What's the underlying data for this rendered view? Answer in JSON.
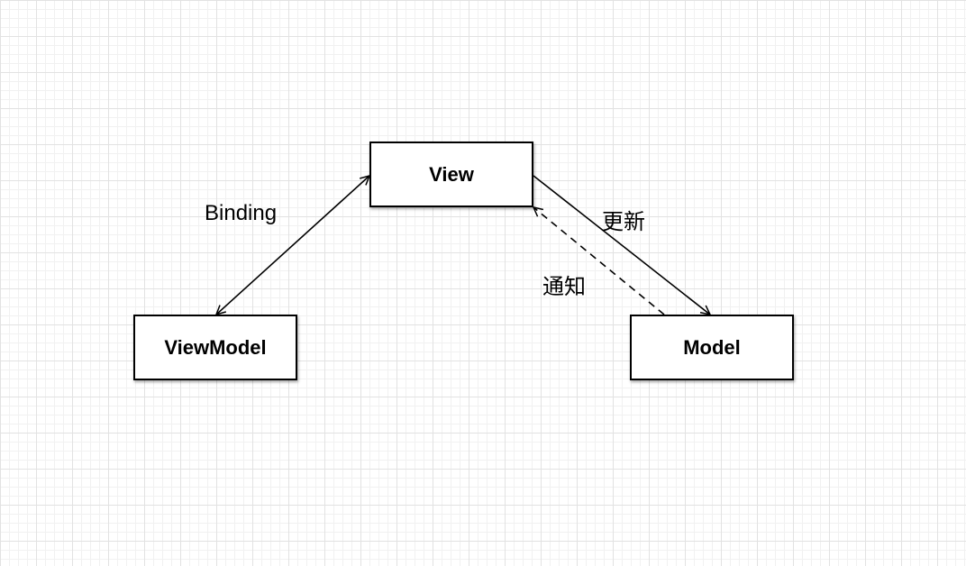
{
  "nodes": {
    "view": "View",
    "viewmodel": "ViewModel",
    "model": "Model"
  },
  "edges": {
    "binding": "Binding",
    "update": "更新",
    "notify": "通知"
  },
  "colors": {
    "line": "#000000",
    "node_fill": "#ffffff",
    "grid_major": "#e2e2e2",
    "grid_minor": "#f1f1f1"
  }
}
